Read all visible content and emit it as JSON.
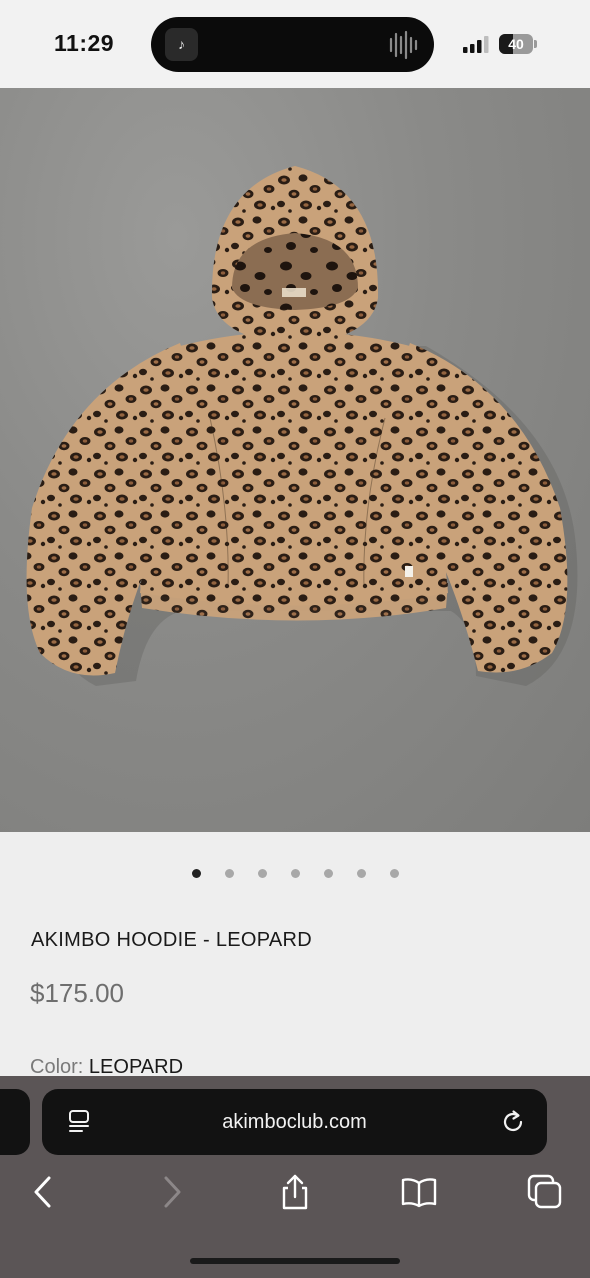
{
  "status_bar": {
    "time": "11:29",
    "battery_percent": "40",
    "battery_level": 0.4,
    "signal_bars_active": 3,
    "now_playing_icon": "music-note-icon",
    "audio_icon": "waveform-icon"
  },
  "product": {
    "image_icon": "leopard-hoodie-photo",
    "carousel": {
      "total": 7,
      "active_index": 0
    },
    "title": "AKIMBO HOODIE - LEOPARD",
    "price": "$175.00",
    "color_label": "Color:",
    "color_value": "LEOPARD"
  },
  "browser": {
    "url": "akimboclub.com",
    "icons": {
      "page_menu": "page-menu-icon",
      "reload": "reload-icon",
      "back": "back-chevron-icon",
      "forward": "forward-chevron-icon",
      "share": "share-icon",
      "bookmarks": "bookmarks-icon",
      "tabs": "tabs-icon"
    },
    "forward_enabled": false
  },
  "colors": {
    "page_bg": "#eeeeee",
    "toolbar_bg": "#5b5556",
    "address_bg": "#121212",
    "active_dot": "#222222",
    "inactive_dot": "#a8a8a8",
    "leopard_base": "#c9a27a",
    "leopard_spot": "#2a1d14"
  }
}
